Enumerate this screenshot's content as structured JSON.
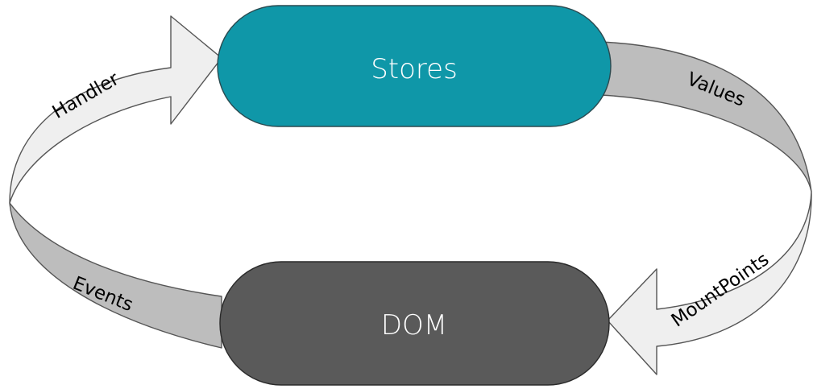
{
  "nodes": {
    "stores": {
      "label": "Stores",
      "color": "#0f97a8"
    },
    "dom": {
      "label": "DOM",
      "color": "#5a5a5a"
    }
  },
  "arrows": {
    "values": {
      "label": "Values"
    },
    "mountpoints": {
      "label": "MountPoints"
    },
    "events": {
      "label": "Events"
    },
    "handler": {
      "label": "Handler"
    }
  },
  "colors": {
    "arrow_light": "#efefef",
    "arrow_dark": "#bdbdbd",
    "outline": "#555555"
  }
}
